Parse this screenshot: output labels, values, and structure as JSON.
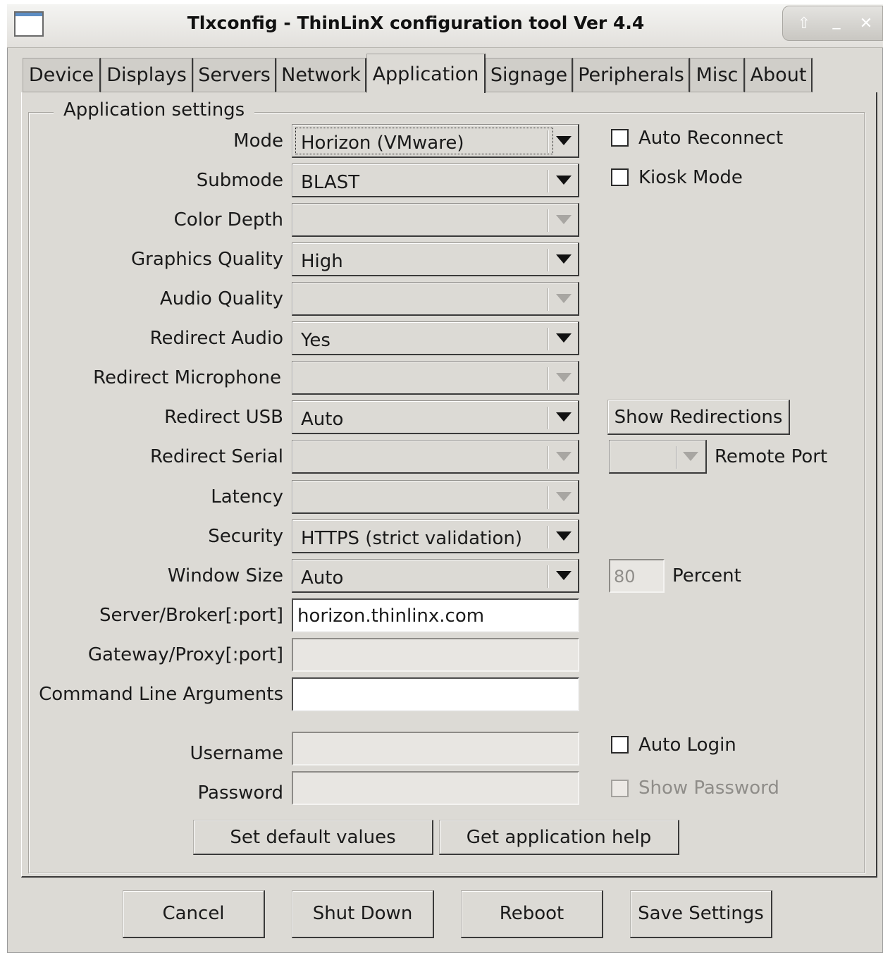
{
  "window": {
    "title": "Tlxconfig - ThinLinX configuration tool Ver 4.4",
    "controls": {
      "up": "⇧",
      "minimize": "_",
      "close": "✕"
    }
  },
  "tabs": [
    "Device",
    "Displays",
    "Servers",
    "Network",
    "Application",
    "Signage",
    "Peripherals",
    "Misc",
    "About"
  ],
  "active_tab": "Application",
  "group": {
    "title": "Application settings"
  },
  "fields": {
    "mode": {
      "label": "Mode",
      "value": "Horizon (VMware)"
    },
    "submode": {
      "label": "Submode",
      "value": "BLAST"
    },
    "color_depth": {
      "label": "Color Depth",
      "value": ""
    },
    "graphics_quality": {
      "label": "Graphics Quality",
      "value": "High"
    },
    "audio_quality": {
      "label": "Audio Quality",
      "value": ""
    },
    "redirect_audio": {
      "label": "Redirect Audio",
      "value": "Yes"
    },
    "redirect_microphone": {
      "label": "Redirect Microphone",
      "value": ""
    },
    "redirect_usb": {
      "label": "Redirect USB",
      "value": "Auto"
    },
    "redirect_serial": {
      "label": "Redirect Serial",
      "value": ""
    },
    "latency": {
      "label": "Latency",
      "value": ""
    },
    "security": {
      "label": "Security",
      "value": "HTTPS (strict validation)"
    },
    "window_size": {
      "label": "Window Size",
      "value": "Auto"
    },
    "server": {
      "label": "Server/Broker[:port]",
      "value": "horizon.thinlinx.com"
    },
    "gateway": {
      "label": "Gateway/Proxy[:port]",
      "value": ""
    },
    "cmdline": {
      "label": "Command Line Arguments",
      "value": ""
    },
    "username": {
      "label": "Username",
      "value": ""
    },
    "password": {
      "label": "Password",
      "value": ""
    }
  },
  "checkboxes": {
    "auto_reconnect": {
      "label": "Auto Reconnect",
      "checked": false
    },
    "kiosk_mode": {
      "label": "Kiosk Mode",
      "checked": false
    },
    "auto_login": {
      "label": "Auto Login",
      "checked": false
    },
    "show_password": {
      "label": "Show Password",
      "checked": false,
      "disabled": true
    }
  },
  "side": {
    "show_redirections": "Show Redirections",
    "remote_port_value": "",
    "remote_port_label": "Remote Port",
    "percent_value": "80",
    "percent_label": "Percent"
  },
  "actions": {
    "set_defaults": "Set default values",
    "get_help": "Get application help"
  },
  "footer": {
    "cancel": "Cancel",
    "shutdown": "Shut Down",
    "reboot": "Reboot",
    "save": "Save Settings"
  }
}
